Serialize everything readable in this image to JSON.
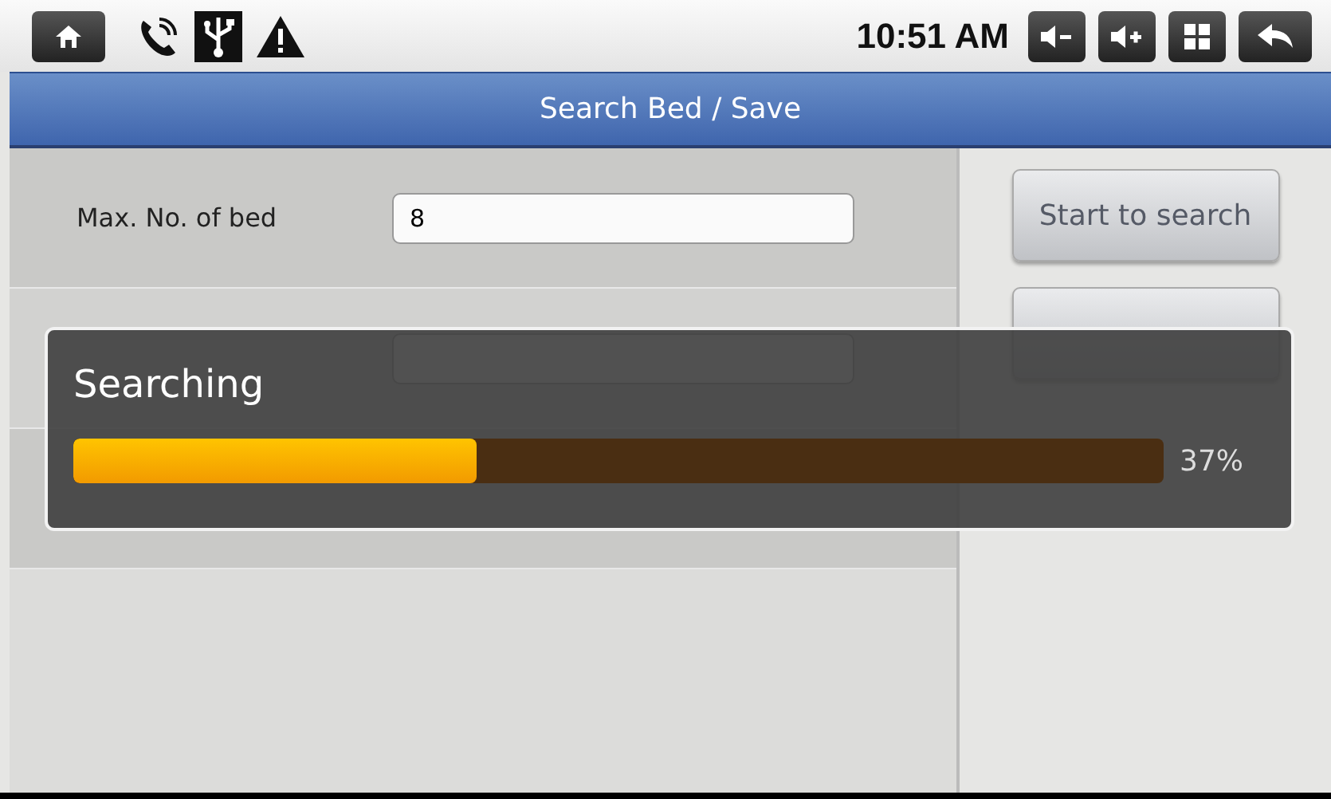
{
  "status_bar": {
    "time": "10:51 AM"
  },
  "window": {
    "title": "Search Bed / Save"
  },
  "form": {
    "rows": [
      {
        "label": "Max. No. of bed",
        "value": "8"
      }
    ]
  },
  "buttons": [
    {
      "label": "Start to search"
    }
  ],
  "dialog": {
    "title": "Searching",
    "progress": {
      "level": 0.37,
      "reading": "37%"
    }
  }
}
